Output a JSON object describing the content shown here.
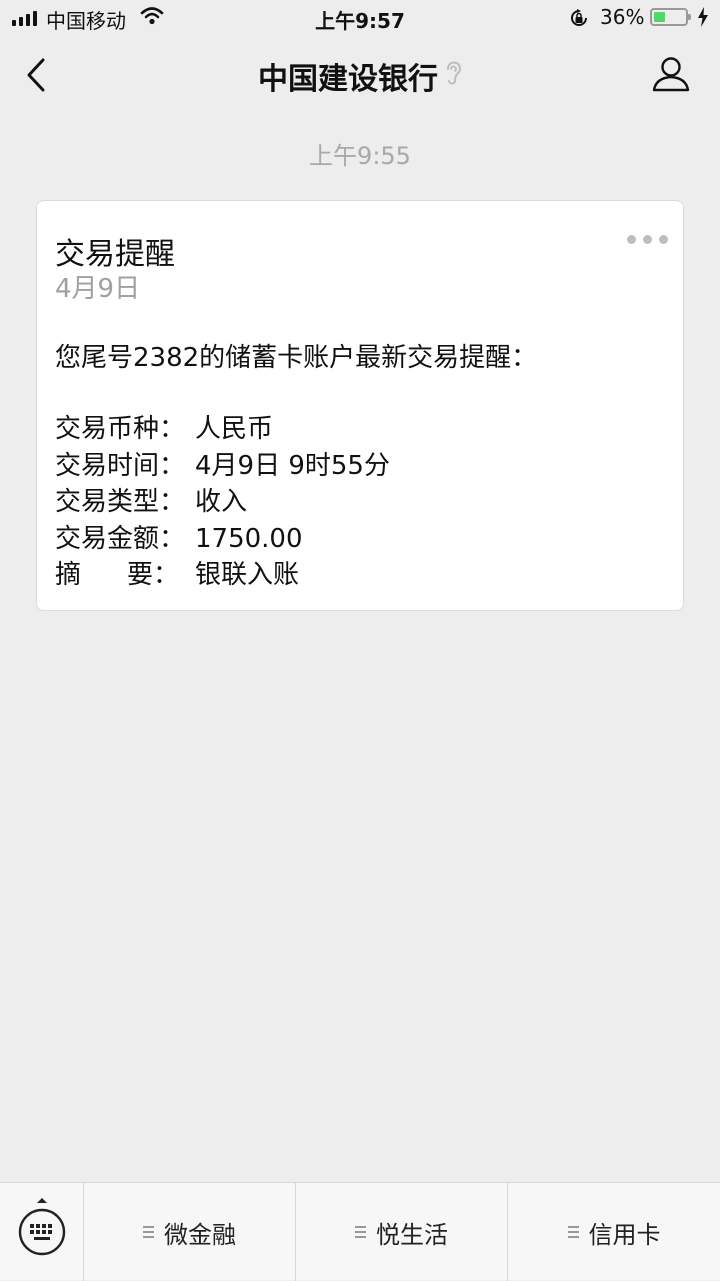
{
  "status_bar": {
    "carrier": "中国移动",
    "time": "上午9:57",
    "battery_percent": "36%",
    "battery_level": 0.36
  },
  "nav": {
    "title": "中国建设银行"
  },
  "message": {
    "timestamp": "上午9:55",
    "card": {
      "title": "交易提醒",
      "date": "4月9日",
      "intro": "您尾号2382的储蓄卡账户最新交易提醒：",
      "rows": [
        {
          "label": "交易币种：",
          "value": "人民币"
        },
        {
          "label": "交易时间：",
          "value": "4月9日 9时55分"
        },
        {
          "label": "交易类型：",
          "value": "收入"
        },
        {
          "label": "交易金额：",
          "value": "1750.00"
        }
      ],
      "summary": {
        "label_a": "摘",
        "label_b": "要：",
        "value": "银联入账"
      }
    }
  },
  "bottom_menu": {
    "items": [
      "微金融",
      "悦生活",
      "信用卡"
    ]
  },
  "colors": {
    "background": "#ededed",
    "battery_fill": "#4cd964",
    "muted_text": "#a8a8a8"
  }
}
